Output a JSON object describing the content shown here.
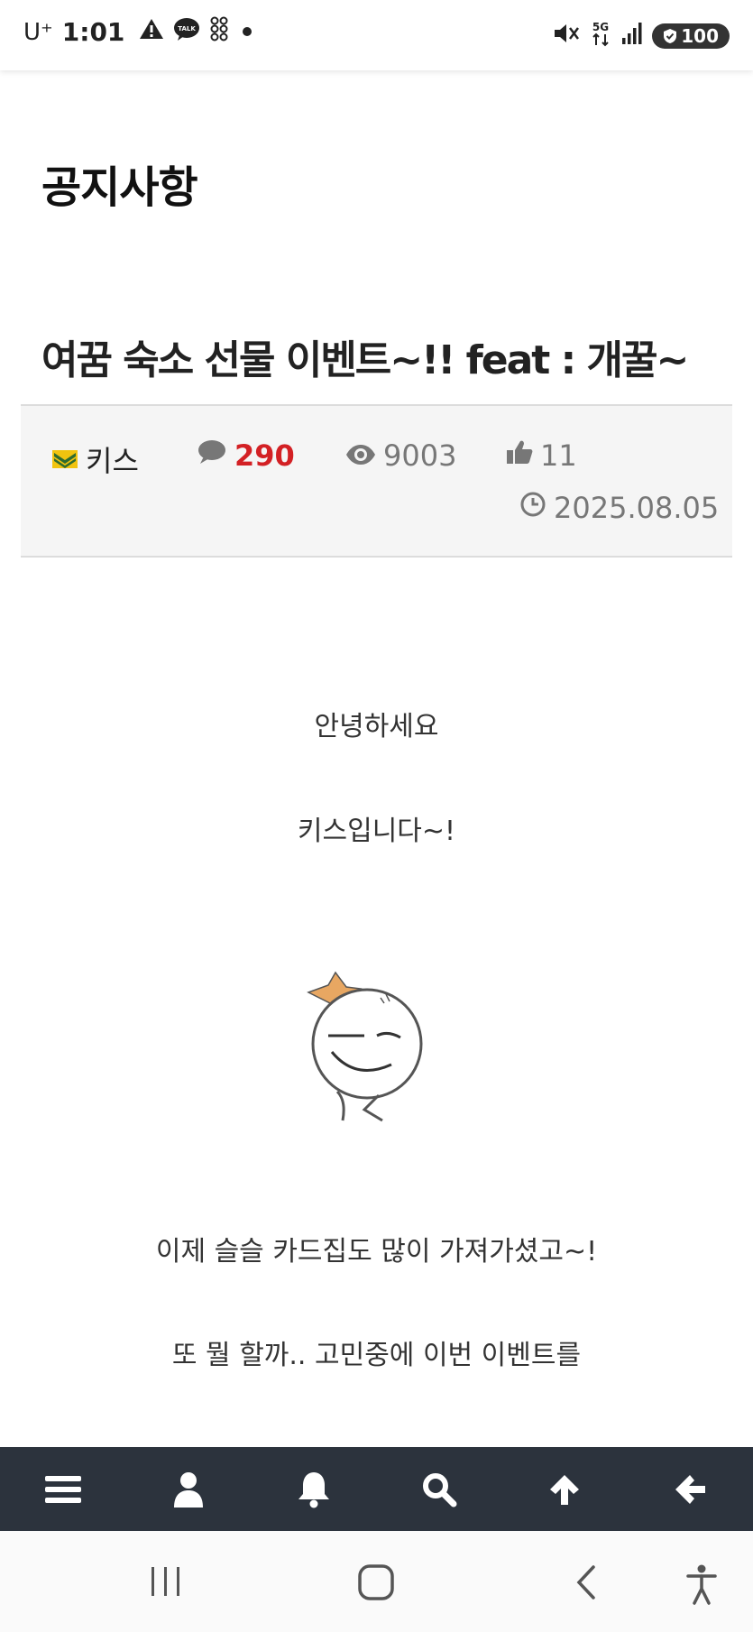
{
  "status_bar": {
    "carrier": "U⁺",
    "time": "1:01",
    "talk_label": "TALK",
    "network": "5G",
    "battery": "100"
  },
  "page": {
    "title": "공지사항"
  },
  "post": {
    "title": "여꿈 숙소 선물 이벤트~!! feat : 개꿀~",
    "author": "키스",
    "comment_count": "290",
    "view_count": "9003",
    "like_count": "11",
    "date": "2025.08.05"
  },
  "content": {
    "lines": [
      "안녕하세요",
      "키스입니다~!",
      "이제 슬슬 카드집도 많이 가져가셨고~!",
      "또 뭘 할까.. 고민중에 이번 이벤트를"
    ]
  },
  "bottom_nav": {
    "items": [
      "menu-icon",
      "user-icon",
      "bell-icon",
      "search-icon",
      "arrow-up-icon",
      "arrow-left-icon"
    ]
  },
  "colors": {
    "accent_red": "#d32024",
    "nav_bg": "#2c333d",
    "meta_bg": "#f5f5f5"
  }
}
